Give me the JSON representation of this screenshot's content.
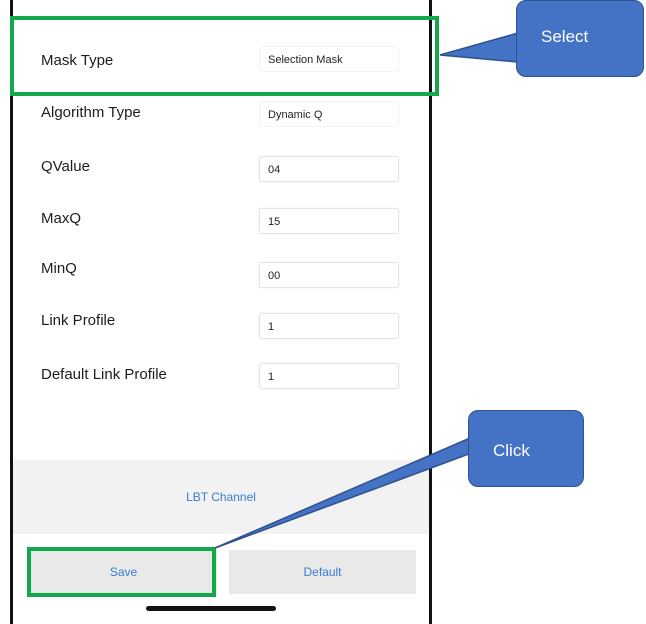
{
  "form": {
    "rows": [
      {
        "label": "Mask Type",
        "value": "Selection Mask"
      },
      {
        "label": "Algorithm Type",
        "value": "Dynamic Q"
      },
      {
        "label": "QValue",
        "value": "04"
      },
      {
        "label": "MaxQ",
        "value": "15"
      },
      {
        "label": "MinQ",
        "value": "00"
      },
      {
        "label": "Link Profile",
        "value": "1"
      },
      {
        "label": "Default Link Profile",
        "value": "1"
      }
    ]
  },
  "lbt_channel_label": "LBT Channel",
  "buttons": {
    "save_label": "Save",
    "default_label": "Default"
  },
  "callouts": {
    "select_label": "Select",
    "click_label": "Click"
  },
  "colors": {
    "highlight": "#12a84b",
    "callout": "#4472c4",
    "link_text": "#3a7bd5"
  }
}
